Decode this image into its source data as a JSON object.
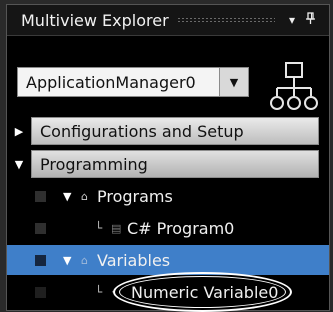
{
  "window": {
    "title": "Multiview Explorer",
    "dropdown_icon": "▾",
    "pin_icon": "pin-icon"
  },
  "selector": {
    "value": "ApplicationManager0",
    "arrow": "▼"
  },
  "sections": [
    {
      "label": "Configurations and Setup",
      "expanded": false
    },
    {
      "label": "Programming",
      "expanded": true
    }
  ],
  "tree": {
    "programs": {
      "label": "Programs"
    },
    "program0": {
      "label": "C# Program0"
    },
    "variables": {
      "label": "Variables",
      "selected": true
    },
    "numeric_variable": {
      "label": "Numeric Variable0",
      "highlighted": true
    }
  },
  "colors": {
    "background": "#000000",
    "selected_row": "#3f7fc9",
    "section_bar": "#d0d0d0"
  }
}
